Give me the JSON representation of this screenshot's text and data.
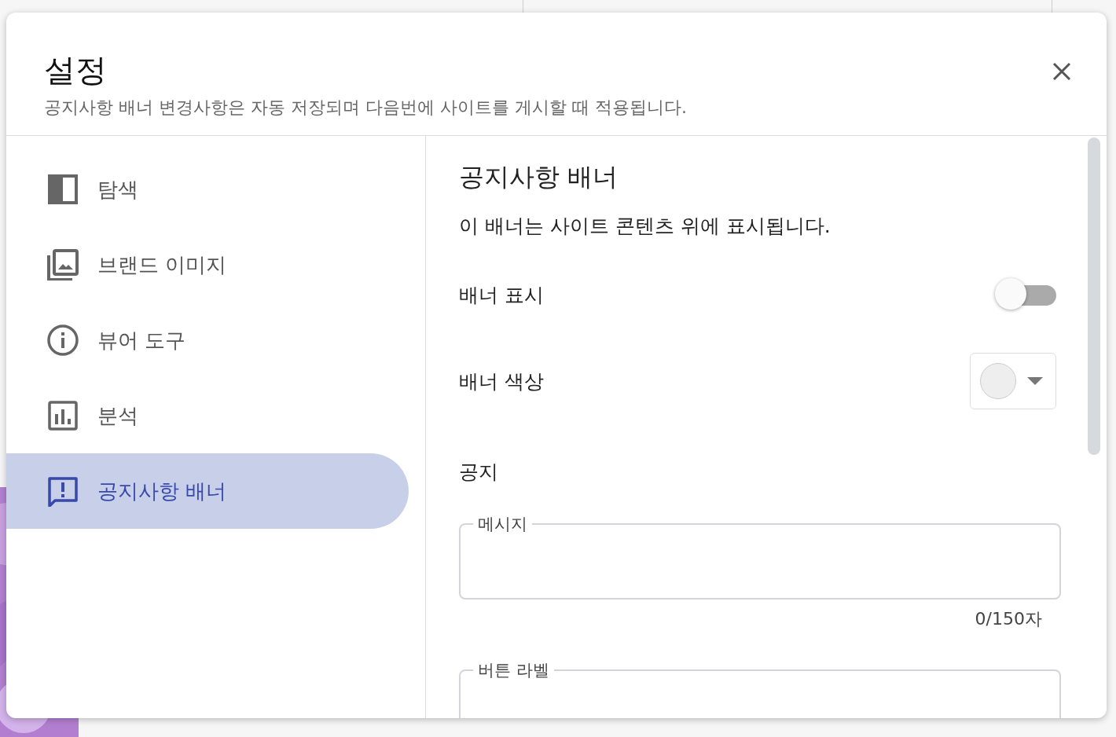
{
  "dialog": {
    "title": "설정",
    "subtitle": "공지사항 배너 변경사항은 자동 저장되며 다음번에 사이트를 게시할 때 적용됩니다."
  },
  "nav": [
    {
      "label": "탐색",
      "selected": false
    },
    {
      "label": "브랜드 이미지",
      "selected": false
    },
    {
      "label": "뷰어 도구",
      "selected": false
    },
    {
      "label": "분석",
      "selected": false
    },
    {
      "label": "공지사항 배너",
      "selected": true
    }
  ],
  "panel": {
    "title": "공지사항 배너",
    "description": "이 배너는 사이트 콘텐츠 위에 표시됩니다.",
    "settings": [
      {
        "kind": "toggle",
        "label": "배너 표시",
        "on": false
      },
      {
        "kind": "color",
        "label": "배너 색상",
        "color": "#eeeeee"
      }
    ],
    "section": "공지",
    "fields": [
      {
        "label": "메시지",
        "counter": "0/150자"
      },
      {
        "label": "버튼 라벨"
      }
    ]
  }
}
